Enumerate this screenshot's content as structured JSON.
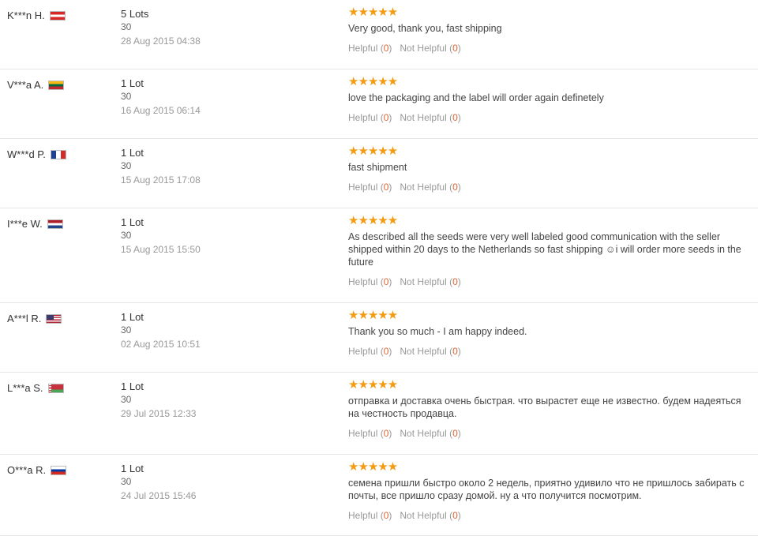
{
  "reviews": [
    {
      "buyer": "K***n H.",
      "country_flag": "austria-flag-icon",
      "lots": "5 Lots",
      "count": "30",
      "date": "28 Aug 2015 04:38",
      "stars": "★★★★★",
      "text": "Very good, thank you, fast shipping",
      "helpful_label": "Helpful",
      "helpful_count": "0",
      "not_helpful_label": "Not Helpful",
      "not_helpful_count": "0"
    },
    {
      "buyer": "V***a A.",
      "country_flag": "lithuania-flag-icon",
      "lots": "1 Lot",
      "count": "30",
      "date": "16 Aug 2015 06:14",
      "stars": "★★★★★",
      "text": "love the packaging and the label will order again definetely",
      "helpful_label": "Helpful",
      "helpful_count": "0",
      "not_helpful_label": "Not Helpful",
      "not_helpful_count": "0"
    },
    {
      "buyer": "W***d P.",
      "country_flag": "france-flag-icon",
      "lots": "1 Lot",
      "count": "30",
      "date": "15 Aug 2015 17:08",
      "stars": "★★★★★",
      "text": "fast shipment",
      "helpful_label": "Helpful",
      "helpful_count": "0",
      "not_helpful_label": "Not Helpful",
      "not_helpful_count": "0"
    },
    {
      "buyer": "I***e W.",
      "country_flag": "netherlands-flag-icon",
      "lots": "1 Lot",
      "count": "30",
      "date": "15 Aug 2015 15:50",
      "stars": "★★★★★",
      "text": "As described all the seeds were very well labeled good communication with the seller shipped within 20 days to the Netherlands so fast shipping ☺i will order more seeds in the future",
      "helpful_label": "Helpful",
      "helpful_count": "0",
      "not_helpful_label": "Not Helpful",
      "not_helpful_count": "0"
    },
    {
      "buyer": "A***l R.",
      "country_flag": "usa-flag-icon",
      "lots": "1 Lot",
      "count": "30",
      "date": "02 Aug 2015 10:51",
      "stars": "★★★★★",
      "text": "Thank you so much - I am happy indeed.",
      "helpful_label": "Helpful",
      "helpful_count": "0",
      "not_helpful_label": "Not Helpful",
      "not_helpful_count": "0"
    },
    {
      "buyer": "L***a S.",
      "country_flag": "belarus-flag-icon",
      "lots": "1 Lot",
      "count": "30",
      "date": "29 Jul 2015 12:33",
      "stars": "★★★★★",
      "text": "отправка и доставка очень быстрая. что вырастет еще не известно. будем надеяться на честность продавца.",
      "helpful_label": "Helpful",
      "helpful_count": "0",
      "not_helpful_label": "Not Helpful",
      "not_helpful_count": "0"
    },
    {
      "buyer": "O***a R.",
      "country_flag": "russia-flag-icon",
      "lots": "1 Lot",
      "count": "30",
      "date": "24 Jul 2015 15:46",
      "stars": "★★★★★",
      "text": "семена пришли быстро около 2 недель, приятно удивило что не пришлось забирать с почты, все пришло сразу домой. ну а что получится посмотрим.",
      "helpful_label": "Helpful",
      "helpful_count": "0",
      "not_helpful_label": "Not Helpful",
      "not_helpful_count": "0"
    }
  ],
  "colors": {
    "star": "#f39c12",
    "vote_count": "#e0642c",
    "divider": "#e5e5e5"
  }
}
